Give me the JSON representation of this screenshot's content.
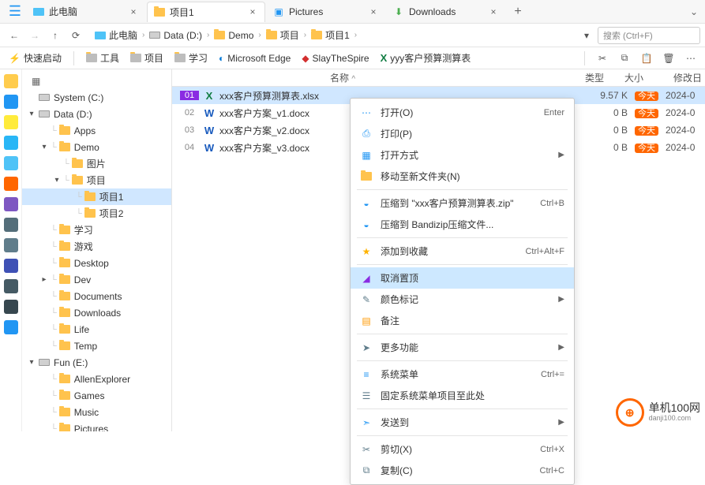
{
  "tabs": [
    {
      "label": "此电脑",
      "icon": "pc",
      "active": false
    },
    {
      "label": "项目1",
      "icon": "folder",
      "active": true
    },
    {
      "label": "Pictures",
      "icon": "picture",
      "active": false
    },
    {
      "label": "Downloads",
      "icon": "download",
      "active": false
    }
  ],
  "breadcrumb": [
    {
      "label": "此电脑",
      "icon": "pc"
    },
    {
      "label": "Data (D:)",
      "icon": "disk"
    },
    {
      "label": "Demo",
      "icon": "folder"
    },
    {
      "label": "项目",
      "icon": "folder"
    },
    {
      "label": "项目1",
      "icon": "folder"
    }
  ],
  "search_placeholder": "搜索 (Ctrl+F)",
  "bookmarks": [
    {
      "label": "快速启动",
      "icon": "flash-blue"
    },
    {
      "label": "工具",
      "icon": "folder-gray"
    },
    {
      "label": "项目",
      "icon": "folder-gray"
    },
    {
      "label": "学习",
      "icon": "folder-gray"
    },
    {
      "label": "Microsoft Edge",
      "icon": "edge"
    },
    {
      "label": "SlayTheSpire",
      "icon": "sts"
    },
    {
      "label": "yyy客户预算测算表",
      "icon": "excel"
    }
  ],
  "tree": [
    {
      "label": "System (C:)",
      "icon": "disk",
      "indent": 1,
      "chev": ""
    },
    {
      "label": "Data (D:)",
      "icon": "disk",
      "indent": 1,
      "chev": "▾"
    },
    {
      "label": "Apps",
      "icon": "folder",
      "indent": 2,
      "chev": ""
    },
    {
      "label": "Demo",
      "icon": "folder",
      "indent": 2,
      "chev": "▾"
    },
    {
      "label": "图片",
      "icon": "folder",
      "indent": 3,
      "chev": ""
    },
    {
      "label": "项目",
      "icon": "folder",
      "indent": 3,
      "chev": "▾"
    },
    {
      "label": "项目1",
      "icon": "folder",
      "indent": 4,
      "selected": true
    },
    {
      "label": "项目2",
      "icon": "folder",
      "indent": 4
    },
    {
      "label": "学习",
      "icon": "folder",
      "indent": 2
    },
    {
      "label": "游戏",
      "icon": "folder",
      "indent": 2
    },
    {
      "label": "Desktop",
      "icon": "folder",
      "indent": 2
    },
    {
      "label": "Dev",
      "icon": "folder",
      "indent": 2,
      "chev": "▸"
    },
    {
      "label": "Documents",
      "icon": "folder",
      "indent": 2
    },
    {
      "label": "Downloads",
      "icon": "folder",
      "indent": 2
    },
    {
      "label": "Life",
      "icon": "folder",
      "indent": 2
    },
    {
      "label": "Temp",
      "icon": "folder",
      "indent": 2
    },
    {
      "label": "Fun (E:)",
      "icon": "disk",
      "indent": 1,
      "chev": "▾"
    },
    {
      "label": "AllenExplorer",
      "icon": "folder",
      "indent": 2
    },
    {
      "label": "Games",
      "icon": "folder",
      "indent": 2
    },
    {
      "label": "Music",
      "icon": "folder",
      "indent": 2
    },
    {
      "label": "Pictures",
      "icon": "folder",
      "indent": 2
    }
  ],
  "columns": {
    "name": "名称",
    "type": "类型",
    "size": "大小",
    "modified": "修改日"
  },
  "files": [
    {
      "idx": "01",
      "name": "xxx客户预算测算表.xlsx",
      "icon": "excel",
      "mark": "",
      "size": "9.57 K",
      "badge": "今天",
      "date": "2024-0",
      "selected": true
    },
    {
      "idx": "02",
      "name": "xxx客户方案_v1.docx",
      "icon": "word",
      "mark": "red",
      "size": "0 B",
      "badge": "今天",
      "date": "2024-0"
    },
    {
      "idx": "03",
      "name": "xxx客户方案_v2.docx",
      "icon": "word",
      "mark": "green",
      "size": "0 B",
      "badge": "今天",
      "date": "2024-0"
    },
    {
      "idx": "04",
      "name": "xxx客户方案_v3.docx",
      "icon": "word",
      "mark": "x",
      "size": "0 B",
      "badge": "今天",
      "date": "2024-0"
    }
  ],
  "context_menu": [
    {
      "label": "打开(O)",
      "icon": "dots-blue",
      "shortcut": "Enter"
    },
    {
      "label": "打印(P)",
      "icon": "printer"
    },
    {
      "label": "打开方式",
      "icon": "app-blue",
      "arrow": true
    },
    {
      "label": "移动至新文件夹(N)",
      "icon": "folder-move"
    },
    {
      "sep": true
    },
    {
      "label": "压缩到 \"xxx客户预算测算表.zip\"",
      "icon": "zip-blue",
      "shortcut": "Ctrl+B"
    },
    {
      "label": "压缩到 Bandizip压缩文件...",
      "icon": "zip-blue"
    },
    {
      "sep": true
    },
    {
      "label": "添加到收藏",
      "icon": "star-yellow",
      "shortcut": "Ctrl+Alt+F"
    },
    {
      "sep": true
    },
    {
      "label": "取消置顶",
      "icon": "pin-purple",
      "highlight": true
    },
    {
      "label": "颜色标记",
      "icon": "pencil",
      "arrow": true
    },
    {
      "label": "备注",
      "icon": "note"
    },
    {
      "sep": true
    },
    {
      "label": "更多功能",
      "icon": "arrow-right",
      "arrow": true
    },
    {
      "sep": true
    },
    {
      "label": "系统菜单",
      "icon": "menu-lines",
      "shortcut": "Ctrl+="
    },
    {
      "label": "固定系统菜单项目至此处",
      "icon": "list"
    },
    {
      "sep": true
    },
    {
      "label": "发送到",
      "icon": "send",
      "arrow": true
    },
    {
      "sep": true
    },
    {
      "label": "剪切(X)",
      "icon": "cut",
      "shortcut": "Ctrl+X"
    },
    {
      "label": "复制(C)",
      "icon": "copy",
      "shortcut": "Ctrl+C"
    }
  ],
  "watermark": {
    "brand": "单机100网",
    "url": "danji100.com"
  },
  "left_strip_colors": [
    "#ffcc4d",
    "#2196f3",
    "#ffeb3b",
    "#29b6f6",
    "#4fc3f7",
    "#ff6600",
    "#7e57c2",
    "#546e7a",
    "#607d8b",
    "#3f51b5",
    "#455a64",
    "#37474f",
    "#2196f3"
  ]
}
